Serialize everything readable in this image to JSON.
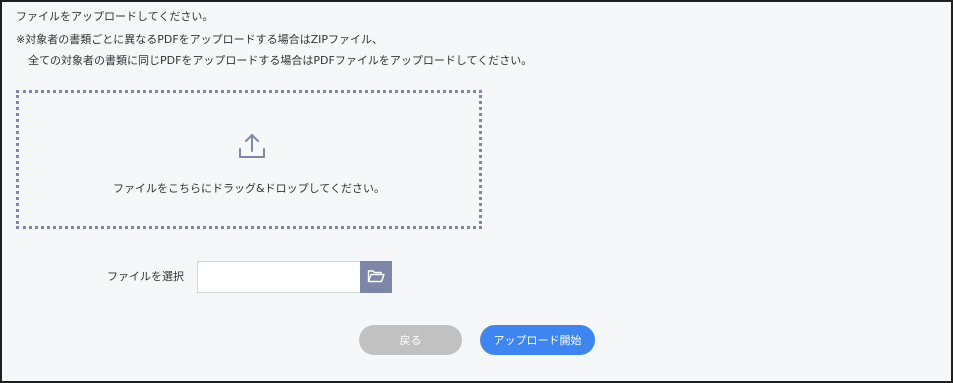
{
  "instructions": {
    "line1": "ファイルをアップロードしてください。",
    "line2": "※対象者の書類ごとに異なるPDFをアップロードする場合はZIPファイル、",
    "line3": "全ての対象者の書類に同じPDFをアップロードする場合はPDFファイルをアップロードしてください。"
  },
  "dropzone": {
    "icon": "upload-icon",
    "text": "ファイルをこちらにドラッグ&ドロップしてください。"
  },
  "file_select": {
    "label": "ファイルを選択",
    "value": "",
    "button_icon": "folder-open-icon"
  },
  "buttons": {
    "back": "戻る",
    "start": "アップロード開始"
  },
  "colors": {
    "accent": "#3d86f2",
    "disabled": "#c1c1c1",
    "dropzone_border": "#7f87a8",
    "folder_button": "#7c86a6"
  }
}
